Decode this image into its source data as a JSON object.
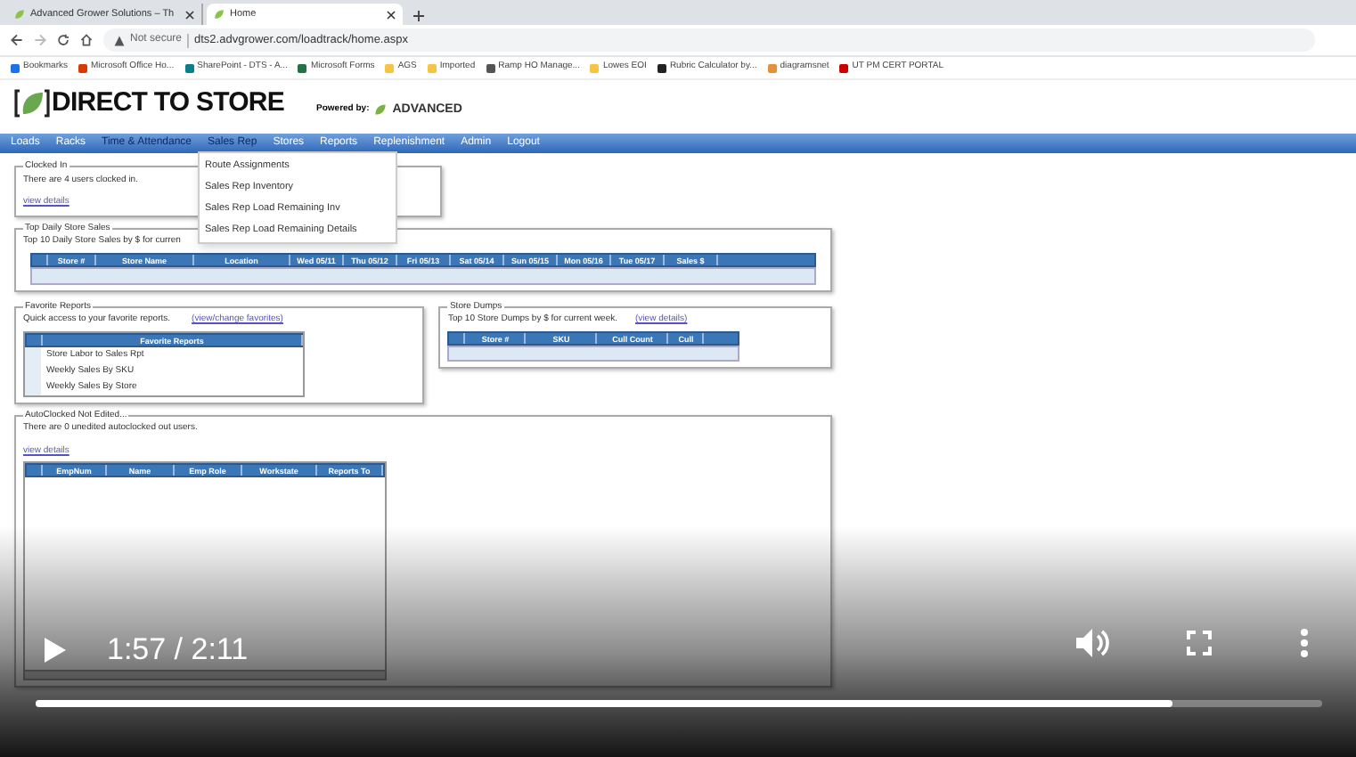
{
  "browser": {
    "tabs": [
      {
        "title": "Advanced Grower Solutions – Th",
        "selected": false
      },
      {
        "title": "Home",
        "selected": true
      }
    ],
    "address": {
      "security": "Not secure",
      "url": "dts2.advgrower.com/loadtrack/home.aspx"
    },
    "bookmarks": [
      "Bookmarks",
      "Microsoft Office Ho...",
      "SharePoint - DTS - A...",
      "Microsoft Forms",
      "AGS",
      "Imported",
      "Ramp HO Manage...",
      "Lowes EOI",
      "Rubric Calculator by...",
      "diagramsnet",
      "UT PM CERT PORTAL"
    ]
  },
  "site": {
    "logo": "DIRECT TO STORE",
    "powered_by": "Powered by:",
    "partner": "ADVANCED",
    "nav": [
      {
        "label": "Loads",
        "highlighted": false
      },
      {
        "label": "Racks",
        "highlighted": false
      },
      {
        "label": "Time & Attendance",
        "highlighted": true
      },
      {
        "label": "Sales Rep",
        "highlighted": true
      },
      {
        "label": "Stores",
        "highlighted": false
      },
      {
        "label": "Reports",
        "highlighted": false
      },
      {
        "label": "Replenishment",
        "highlighted": false
      },
      {
        "label": "Admin",
        "highlighted": false
      },
      {
        "label": "Logout",
        "highlighted": false
      }
    ],
    "menu": [
      "Route Assignments",
      "Sales Rep Inventory",
      "Sales Rep Load Remaining Inv",
      "Sales Rep Load Remaining Details"
    ]
  },
  "clocked_in": {
    "title": "Clocked In",
    "text": "There are 4 users clocked in.",
    "link": "view details"
  },
  "top_sales": {
    "title": "Top Daily Store Sales",
    "text": "Top 10 Daily Store Sales by $ for curren",
    "columns": [
      "Store #",
      "Store Name",
      "Location",
      "Wed 05/11",
      "Thu 05/12",
      "Fri 05/13",
      "Sat 05/14",
      "Sun 05/15",
      "Mon 05/16",
      "Tue 05/17",
      "Sales $"
    ]
  },
  "favorites": {
    "title": "Favorite Reports",
    "text": "Quick access to your favorite reports.",
    "link": "(view/change favorites)",
    "header": "Favorite Reports",
    "rows": [
      "Store Labor to Sales Rpt",
      "Weekly Sales By SKU",
      "Weekly Sales By Store"
    ]
  },
  "dumps": {
    "title": "Store Dumps",
    "text": "Top 10 Store Dumps by $ for current week.",
    "link": "(view details)",
    "columns": [
      "Store #",
      "SKU",
      "Cull Count",
      "Cull"
    ]
  },
  "autoclocked": {
    "title": "AutoClocked Not Edited...",
    "text": "There are 0 unedited autoclocked out users.",
    "link": "view details",
    "columns": [
      "EmpNum",
      "Name",
      "Emp Role",
      "Workstate",
      "Reports To"
    ]
  },
  "player": {
    "time": "1:57 / 2:11",
    "level": 0.884
  }
}
